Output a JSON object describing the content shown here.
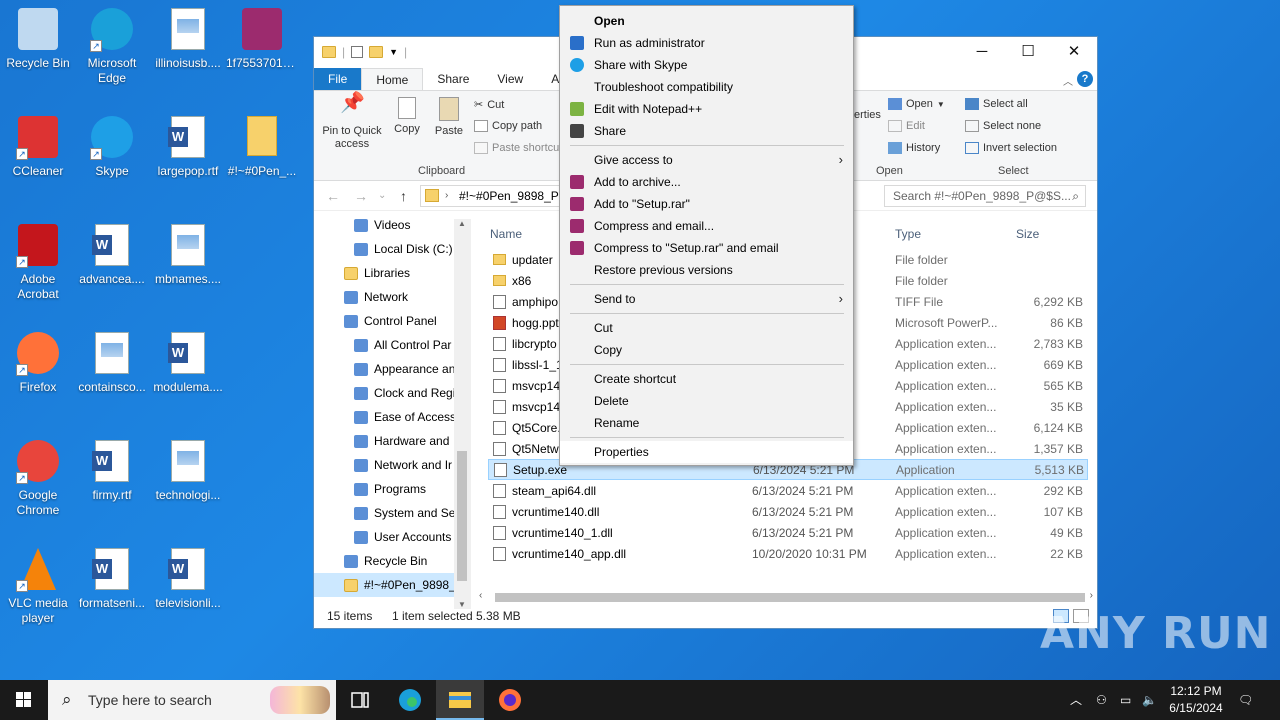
{
  "desktop": {
    "icons": [
      {
        "label": "Recycle Bin",
        "icon": "recycle-bin-icon"
      },
      {
        "label": "Microsoft Edge",
        "icon": "edge-icon"
      },
      {
        "label": "illinoisusb....",
        "icon": "image-file-icon"
      },
      {
        "label": "1f7553701e...",
        "icon": "winrar-icon"
      },
      {
        "label": "CCleaner",
        "icon": "ccleaner-icon"
      },
      {
        "label": "Skype",
        "icon": "skype-icon"
      },
      {
        "label": "largepop.rtf",
        "icon": "word-file-icon"
      },
      {
        "label": "#!~#0Pen_...",
        "icon": "folder-icon"
      },
      {
        "label": "Adobe Acrobat",
        "icon": "acrobat-icon"
      },
      {
        "label": "advancea....",
        "icon": "word-file-icon"
      },
      {
        "label": "mbnames....",
        "icon": "image-file-icon"
      },
      {
        "label": "Firefox",
        "icon": "firefox-icon"
      },
      {
        "label": "containsco...",
        "icon": "image-file-icon"
      },
      {
        "label": "modulema....",
        "icon": "word-file-icon"
      },
      {
        "label": "Google Chrome",
        "icon": "chrome-icon"
      },
      {
        "label": "firmy.rtf",
        "icon": "word-file-icon"
      },
      {
        "label": "technologi...",
        "icon": "image-file-icon"
      },
      {
        "label": "VLC media player",
        "icon": "vlc-icon"
      },
      {
        "label": "formatseni...",
        "icon": "word-file-icon"
      },
      {
        "label": "televisionli...",
        "icon": "word-file-icon"
      }
    ]
  },
  "explorer": {
    "tabs": [
      "File",
      "Home",
      "Share",
      "View",
      "A"
    ],
    "clipboard": {
      "pin": "Pin to Quick access",
      "copy": "Copy",
      "paste": "Paste",
      "cut": "Cut",
      "copy_path": "Copy path",
      "paste_shortcut": "Paste shortcut",
      "group": "Clipboard"
    },
    "open_group": {
      "properties": "erties",
      "open": "Open",
      "edit": "Edit",
      "history": "History",
      "group": "Open"
    },
    "select_group": {
      "select_all": "Select all",
      "select_none": "Select none",
      "invert": "Invert selection",
      "group": "Select"
    },
    "address": "#!~#0Pen_9898_P@",
    "search_placeholder": "Search #!~#0Pen_9898_P@$S...",
    "columns": {
      "name": "Name",
      "type": "Type",
      "size": "Size"
    },
    "nav": [
      {
        "label": "Videos",
        "indent": 1
      },
      {
        "label": "Local Disk (C:)",
        "indent": 1
      },
      {
        "label": "Libraries",
        "indent": 0
      },
      {
        "label": "Network",
        "indent": 0
      },
      {
        "label": "Control Panel",
        "indent": 0
      },
      {
        "label": "All Control Par",
        "indent": 1
      },
      {
        "label": "Appearance an",
        "indent": 1
      },
      {
        "label": "Clock and Regi",
        "indent": 1
      },
      {
        "label": "Ease of Access",
        "indent": 1
      },
      {
        "label": "Hardware and",
        "indent": 1
      },
      {
        "label": "Network and Ir",
        "indent": 1
      },
      {
        "label": "Programs",
        "indent": 1
      },
      {
        "label": "System and Se",
        "indent": 1
      },
      {
        "label": "User Accounts",
        "indent": 1
      },
      {
        "label": "Recycle Bin",
        "indent": 0
      },
      {
        "label": "#!~#0Pen_9898_",
        "indent": 0
      }
    ],
    "files": [
      {
        "name": "updater",
        "date": "",
        "type": "File folder",
        "size": "",
        "kind": "folder"
      },
      {
        "name": "x86",
        "date": "",
        "type": "File folder",
        "size": "",
        "kind": "folder"
      },
      {
        "name": "amphipo",
        "date": "",
        "type": "TIFF File",
        "size": "6,292 KB",
        "kind": "file"
      },
      {
        "name": "hogg.ppt",
        "date": "",
        "type": "Microsoft PowerP...",
        "size": "86 KB",
        "kind": "ppt"
      },
      {
        "name": "libcrypto",
        "date": "",
        "type": "Application exten...",
        "size": "2,783 KB",
        "kind": "file"
      },
      {
        "name": "libssl-1_1",
        "date": "",
        "type": "Application exten...",
        "size": "669 KB",
        "kind": "file"
      },
      {
        "name": "msvcp14",
        "date": "",
        "type": "Application exten...",
        "size": "565 KB",
        "kind": "file"
      },
      {
        "name": "msvcp14",
        "date": "",
        "type": "Application exten...",
        "size": "35 KB",
        "kind": "file"
      },
      {
        "name": "Qt5Core.",
        "date": "",
        "type": "Application exten...",
        "size": "6,124 KB",
        "kind": "file"
      },
      {
        "name": "Qt5Netw",
        "date": "",
        "type": "Application exten...",
        "size": "1,357 KB",
        "kind": "file"
      },
      {
        "name": "Setup.exe",
        "date": "6/13/2024 5:21 PM",
        "type": "Application",
        "size": "5,513 KB",
        "kind": "file",
        "selected": true
      },
      {
        "name": "steam_api64.dll",
        "date": "6/13/2024 5:21 PM",
        "type": "Application exten...",
        "size": "292 KB",
        "kind": "file"
      },
      {
        "name": "vcruntime140.dll",
        "date": "6/13/2024 5:21 PM",
        "type": "Application exten...",
        "size": "107 KB",
        "kind": "file"
      },
      {
        "name": "vcruntime140_1.dll",
        "date": "6/13/2024 5:21 PM",
        "type": "Application exten...",
        "size": "49 KB",
        "kind": "file"
      },
      {
        "name": "vcruntime140_app.dll",
        "date": "10/20/2020 10:31 PM",
        "type": "Application exten...",
        "size": "22 KB",
        "kind": "file"
      }
    ],
    "status": {
      "items": "15 items",
      "selected": "1 item selected",
      "size": "5.38 MB"
    }
  },
  "context_menu": {
    "items": [
      {
        "label": "Open",
        "bold": true,
        "icon": "",
        "sep_after": false
      },
      {
        "label": "Run as administrator",
        "icon": "shield-icon"
      },
      {
        "label": "Share with Skype",
        "icon": "skype-icon"
      },
      {
        "label": "Troubleshoot compatibility",
        "icon": ""
      },
      {
        "label": "Edit with Notepad++",
        "icon": "notepadpp-icon"
      },
      {
        "label": "Share",
        "icon": "share-icon",
        "sep_after": true
      },
      {
        "label": "Give access to",
        "icon": "",
        "submenu": true,
        "sep_after": false
      },
      {
        "label": "Add to archive...",
        "icon": "winrar-icon"
      },
      {
        "label": "Add to \"Setup.rar\"",
        "icon": "winrar-icon"
      },
      {
        "label": "Compress and email...",
        "icon": "winrar-icon"
      },
      {
        "label": "Compress to \"Setup.rar\" and email",
        "icon": "winrar-icon"
      },
      {
        "label": "Restore previous versions",
        "icon": "",
        "sep_after": true
      },
      {
        "label": "Send to",
        "icon": "",
        "submenu": true,
        "sep_after": true
      },
      {
        "label": "Cut",
        "icon": ""
      },
      {
        "label": "Copy",
        "icon": "",
        "sep_after": true
      },
      {
        "label": "Create shortcut",
        "icon": ""
      },
      {
        "label": "Delete",
        "icon": ""
      },
      {
        "label": "Rename",
        "icon": "",
        "sep_after": true
      },
      {
        "label": "Properties",
        "icon": "",
        "highlighted": true
      }
    ]
  },
  "taskbar": {
    "search_placeholder": "Type here to search",
    "time": "12:12 PM",
    "date": "6/15/2024"
  },
  "watermark": "ANY RUN"
}
